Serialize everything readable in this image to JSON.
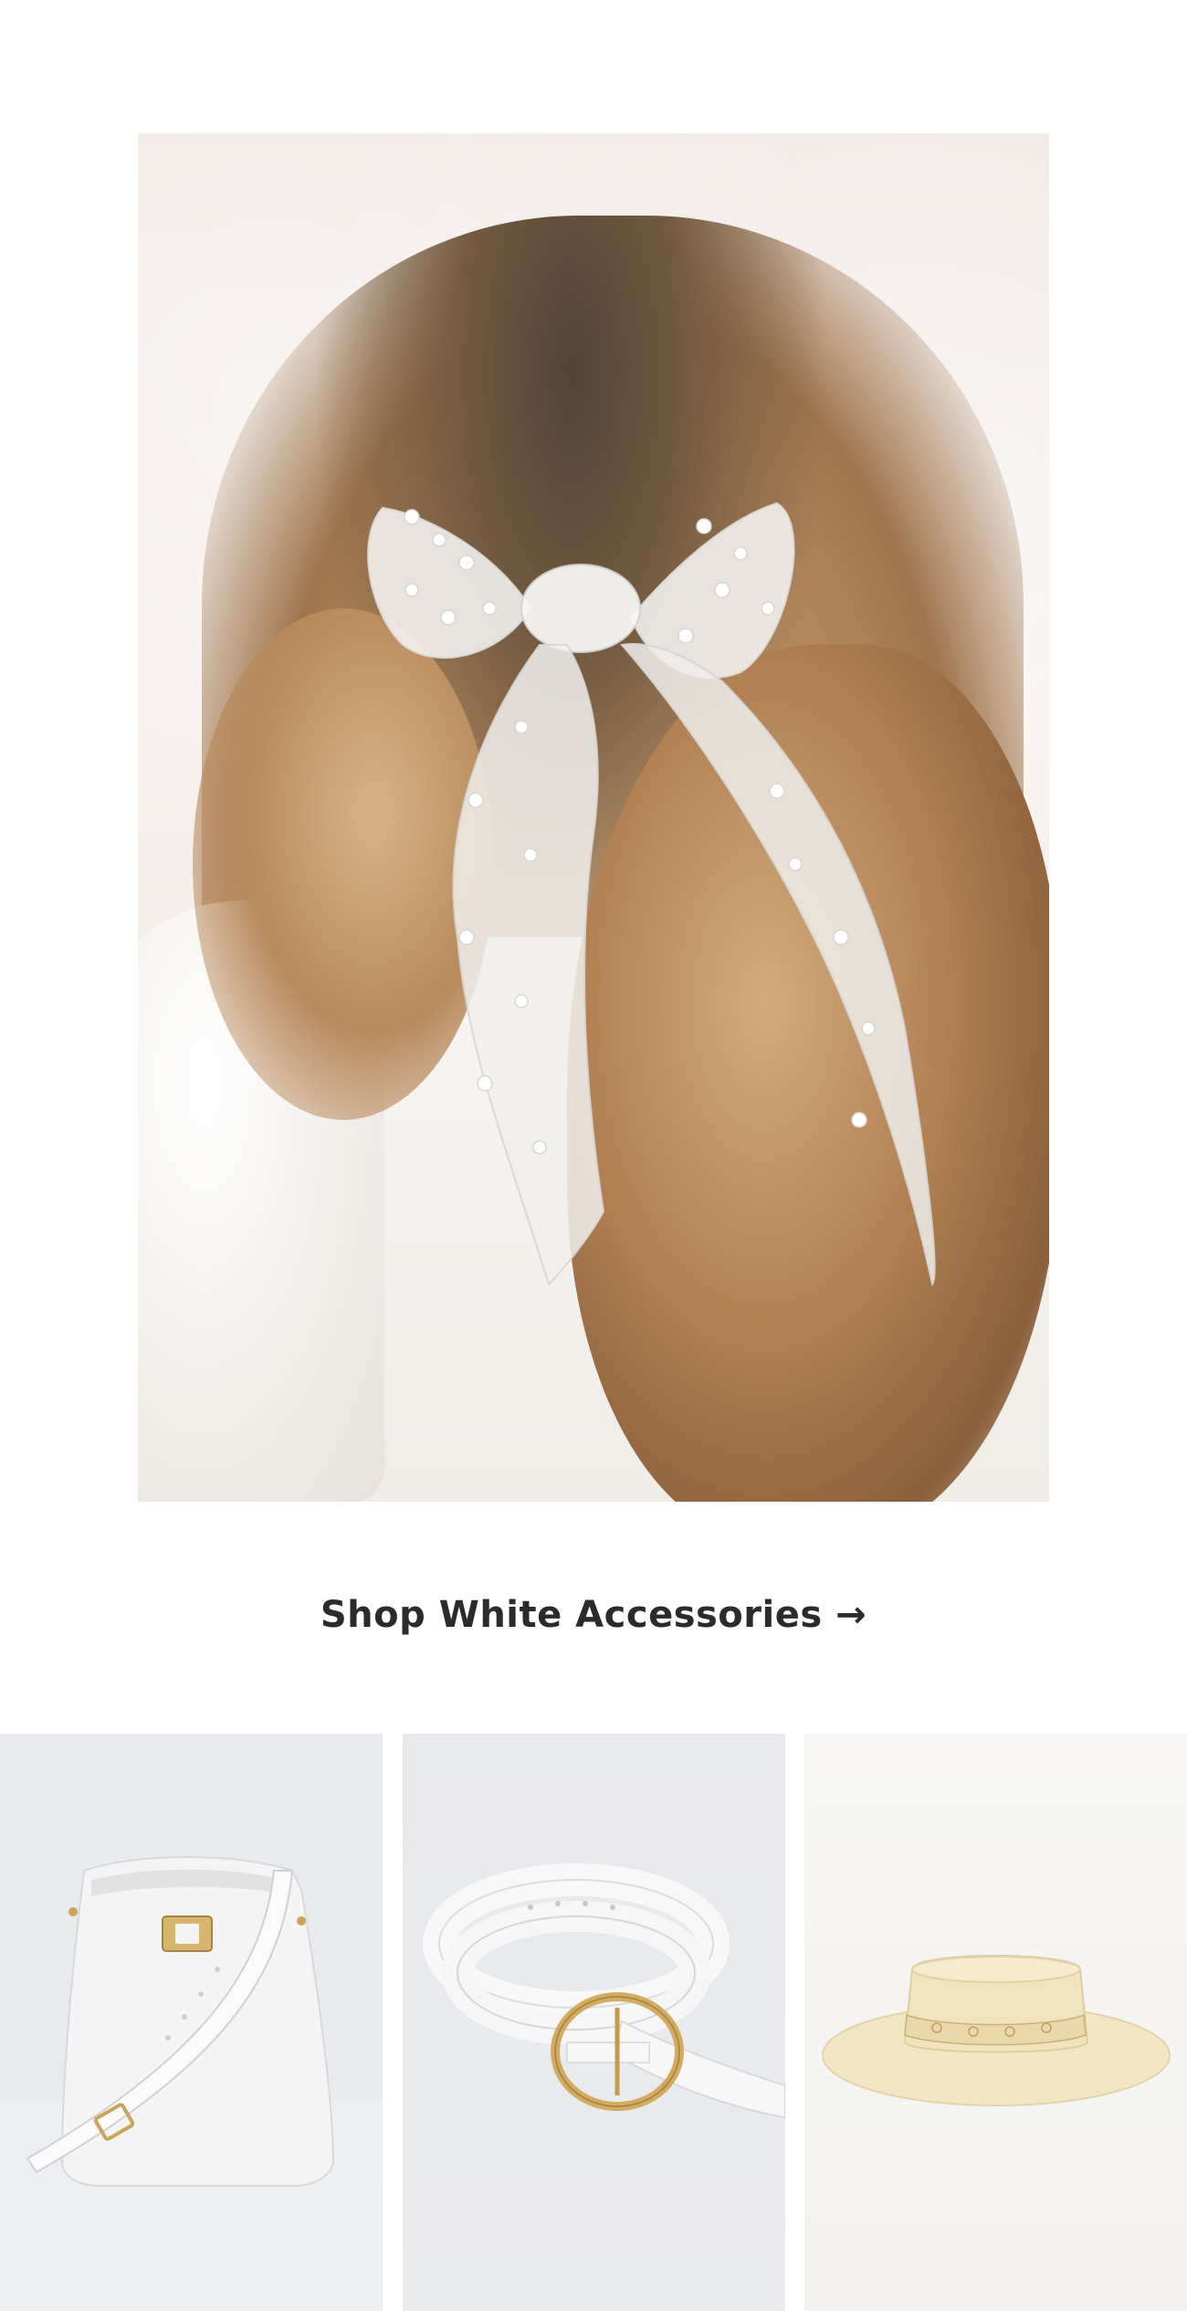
{
  "hero": {
    "image_alt": "Model wearing a white tulle pearl hair bow"
  },
  "cta": {
    "label": "Shop White Accessories →"
  },
  "products": [
    {
      "name": "white-bucket-bag",
      "icon": "white-handbag"
    },
    {
      "name": "white-belt",
      "icon": "white-belt-gold-buckle"
    },
    {
      "name": "cream-boater-hat",
      "icon": "cream-wide-brim-hat"
    }
  ],
  "colors": {
    "text": "#2b2b2b",
    "background": "#ffffff",
    "tile_gray": "#e9ebef",
    "tile_cream": "#f5f4f2",
    "gold": "#c9a45a"
  }
}
